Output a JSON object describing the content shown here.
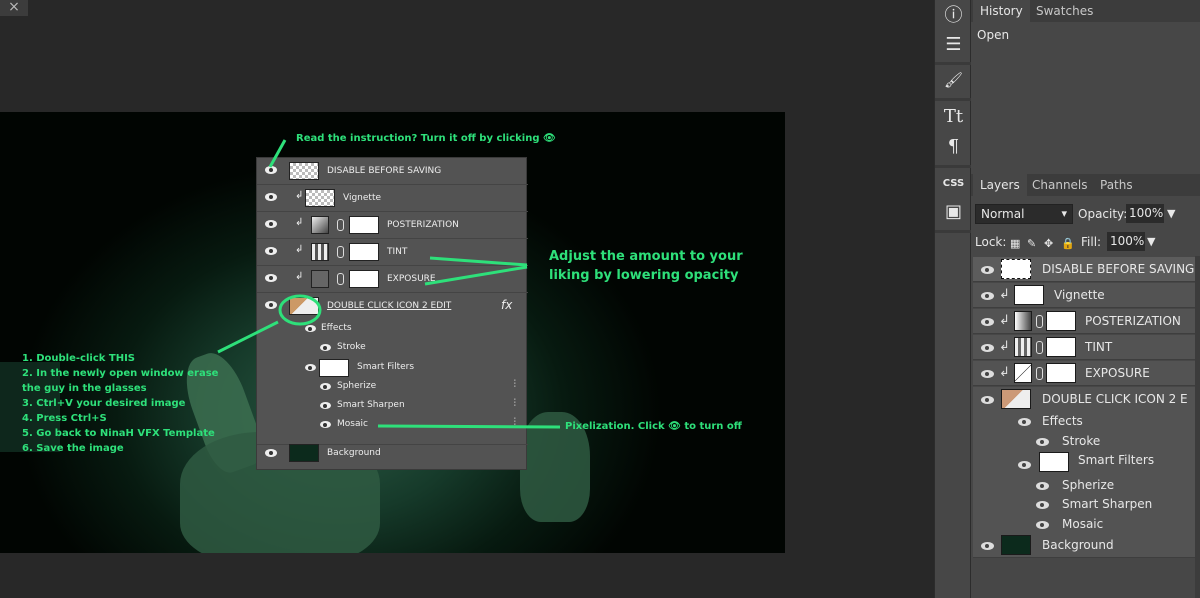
{
  "workspace": {
    "close_icon": "×",
    "canvas": {
      "annotations": {
        "top": "Read the instruction? Turn it off by clicking 👁",
        "opacity_line1": "Adjust the amount to your",
        "opacity_line2": "liking by lowering opacity",
        "pixel": "Pixelization. Click 👁 to turn off",
        "steps": [
          "1. Double-click THIS",
          "2. In the newly open window erase",
          "the guy in the glasses",
          "3. Ctrl+V your desired image",
          "4. Press Ctrl+S",
          "5. Go back to NinaH VFX Template",
          "6. Save the image"
        ]
      },
      "overlay_layers": {
        "rows": [
          "DISABLE BEFORE SAVING",
          "Vignette",
          "POSTERIZATION",
          "TINT",
          "EXPOSURE",
          "DOUBLE CLICK ICON 2 EDIT"
        ],
        "effects_label": "Effects",
        "stroke_label": "Stroke",
        "smart_filters_label": "Smart Filters",
        "filters": [
          "Spherize",
          "Smart Sharpen",
          "Mosaic"
        ],
        "background_label": "Background",
        "fx_label": "fx",
        "clip_icon": "↲",
        "slider_icon": "⫶"
      }
    }
  },
  "tools": {
    "info": "ⓘ",
    "adjust": "☰",
    "brush": "🖌",
    "type": "Tt",
    "paragraph": "¶",
    "css": "CSS",
    "image": "▣"
  },
  "right": {
    "history_tabs": [
      "History",
      "Swatches"
    ],
    "history_items": [
      "Open"
    ],
    "layers_tabs": [
      "Layers",
      "Channels",
      "Paths"
    ],
    "blend_mode": "Normal",
    "opacity_label": "Opacity:",
    "opacity_value": "100%",
    "lock_label": "Lock:",
    "fill_label": "Fill:",
    "fill_value": "100%",
    "caret": "▼",
    "clip_icon": "↲",
    "layers": {
      "disable": "DISABLE BEFORE SAVING",
      "vignette": "Vignette",
      "posterization": "POSTERIZATION",
      "tint": "TINT",
      "exposure": "EXPOSURE",
      "smart": "DOUBLE CLICK ICON 2 E",
      "background": "Background"
    },
    "effects_label": "Effects",
    "stroke_label": "Stroke",
    "smart_filters_label": "Smart Filters",
    "filters": [
      "Spherize",
      "Smart Sharpen",
      "Mosaic"
    ],
    "lock_icons": [
      "▦",
      "✎",
      "✥",
      "🔒"
    ]
  }
}
